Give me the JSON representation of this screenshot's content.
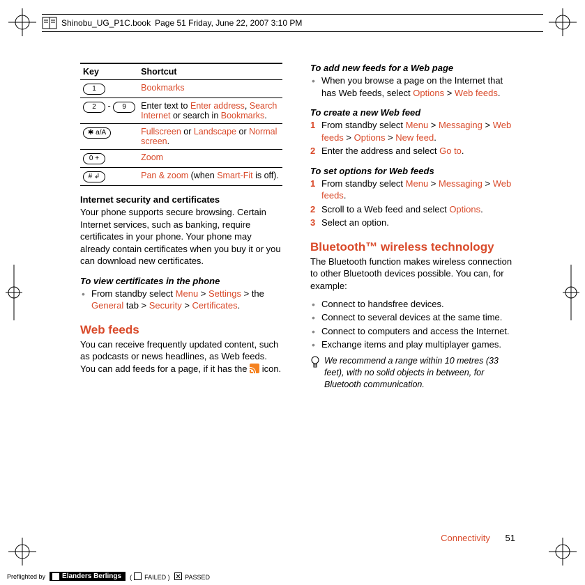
{
  "header": {
    "filename": "Shinobu_UG_P1C.book",
    "page_info": "Page 51  Friday, June 22, 2007  3:10 PM"
  },
  "footer": {
    "section": "Connectivity",
    "page": "51"
  },
  "preflight": {
    "label": "Preflighted by",
    "brand": "Elanders Berlings",
    "failed": "FAILED",
    "passed": "PASSED"
  },
  "left": {
    "table": {
      "head_key": "Key",
      "head_shortcut": "Shortcut",
      "rows": [
        {
          "key_html": "1",
          "text_before": "",
          "link": "Bookmarks",
          "text_after": ""
        },
        {
          "key_html": "2 - 9",
          "text_before": "Enter text to ",
          "link1": "Enter address",
          "sep1": ", ",
          "link2": "Search Internet",
          "sep2": " or search in ",
          "link3": "Bookmarks",
          "suffix": "."
        },
        {
          "key_html": "* a/A",
          "link1": "Fullscreen",
          "sep1": " or ",
          "link2": "Landscape",
          "sep2": " or ",
          "link3": "Normal screen",
          "suffix": "."
        },
        {
          "key_html": "0 +",
          "link": "Zoom"
        },
        {
          "key_html": "# ⇧",
          "link": "Pan & zoom",
          "text_after": " (when ",
          "link2": "Smart-Fit",
          "suffix": " is off)."
        }
      ]
    },
    "sec1_title": "Internet security and certificates",
    "sec1_body": "Your phone supports secure browsing. Certain Internet services, such as banking, require certificates in your phone. Your phone may already contain certificates when you buy it or you can download new certificates.",
    "sec2_title": "To view certificates in the phone",
    "sec2_item_prefix": "From standby select ",
    "sec2_menu1": "Menu",
    "sec2_gt1": " > ",
    "sec2_menu2": "Settings",
    "sec2_gt2": " > the ",
    "sec2_menu3": "General",
    "sec2_after3": " tab > ",
    "sec2_menu4": "Security",
    "sec2_gt4": " > ",
    "sec2_menu5": "Certificates",
    "sec2_suffix": ".",
    "webfeeds_title": "Web feeds",
    "webfeeds_body_before": "You can receive frequently updated content, such as podcasts or news headlines, as Web feeds. You can add feeds for a page, if it has the ",
    "webfeeds_body_after": " icon."
  },
  "right": {
    "add_title": "To add new feeds for a Web page",
    "add_item_prefix": "When you browse a page on the Internet that has Web feeds, select ",
    "add_menu1": "Options",
    "add_gt1": " > ",
    "add_menu2": "Web feeds",
    "add_suffix": ".",
    "create_title": "To create a new Web feed",
    "create_step1_prefix": "From standby select ",
    "create_m1": "Menu",
    "g1": " > ",
    "create_m2": "Messaging",
    "g2": " > ",
    "create_m3": "Web feeds",
    "g3": " > ",
    "create_m4": "Options",
    "g4": " > ",
    "create_m5": "New feed",
    "create_suffix1": ".",
    "create_step2_prefix": "Enter the address and select ",
    "create_m6": "Go to",
    "create_suffix2": ".",
    "setopt_title": "To set options for Web feeds",
    "setopt_step1_prefix": "From standby select ",
    "so_m1": "Menu",
    "so_m2": "Messaging",
    "so_m3": "Web feeds",
    "so_suffix1": ".",
    "setopt_step2_prefix": "Scroll to a Web feed and select ",
    "so_m4": "Options",
    "so_suffix2": ".",
    "setopt_step3": "Select an option.",
    "bt_title": "Bluetooth™ wireless technology",
    "bt_intro": "The Bluetooth function makes wireless connection to other Bluetooth devices possible. You can, for example:",
    "bt_b1": "Connect to handsfree devices.",
    "bt_b2": "Connect to several devices at the same time.",
    "bt_b3": "Connect to computers and access the Internet.",
    "bt_b4": "Exchange items and play multiplayer games.",
    "tip": "We recommend a range within 10 metres (33 feet), with no solid objects in between, for Bluetooth communication."
  }
}
